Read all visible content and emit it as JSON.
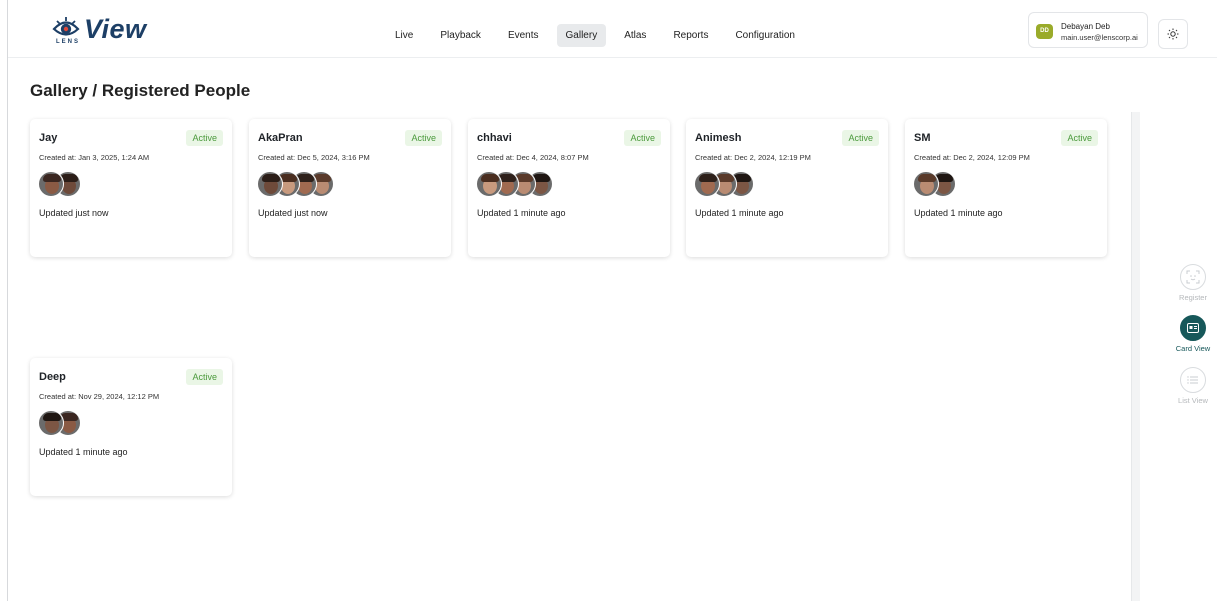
{
  "brand": {
    "name": "View",
    "sub": "LENS",
    "accent": "#1d3f66"
  },
  "nav": {
    "items": [
      {
        "label": "Live"
      },
      {
        "label": "Playback"
      },
      {
        "label": "Events"
      },
      {
        "label": "Gallery"
      },
      {
        "label": "Atlas"
      },
      {
        "label": "Reports"
      },
      {
        "label": "Configuration"
      }
    ],
    "active": "Gallery"
  },
  "user": {
    "initials": "DD",
    "name": "Debayan Deb",
    "email": "main.user@lenscorp.ai"
  },
  "page": {
    "title": "Gallery / Registered People"
  },
  "status_colors": {
    "active_bg": "#eaf6e6",
    "active_text": "#4b9a3c"
  },
  "people": [
    {
      "name": "Jay",
      "status": "Active",
      "created": "Created at: Jan 3, 2025, 1:24 AM",
      "updated": "Updated just now",
      "photo_count": 2
    },
    {
      "name": "AkaPran",
      "status": "Active",
      "created": "Created at: Dec 5, 2024, 3:16 PM",
      "updated": "Updated just now",
      "photo_count": 4
    },
    {
      "name": "chhavi",
      "status": "Active",
      "created": "Created at: Dec 4, 2024, 8:07 PM",
      "updated": "Updated 1 minute ago",
      "photo_count": 4
    },
    {
      "name": "Animesh",
      "status": "Active",
      "created": "Created at: Dec 2, 2024, 12:19 PM",
      "updated": "Updated 1 minute ago",
      "photo_count": 3
    },
    {
      "name": "SM",
      "status": "Active",
      "created": "Created at: Dec 2, 2024, 12:09 PM",
      "updated": "Updated 1 minute ago",
      "photo_count": 2
    },
    {
      "name": "Deep",
      "status": "Active",
      "created": "Created at: Nov 29, 2024, 12:12 PM",
      "updated": "Updated 1 minute ago",
      "photo_count": 2
    }
  ],
  "tools": [
    {
      "label": "Register",
      "icon": "face-scan-icon",
      "active": false
    },
    {
      "label": "Card View",
      "icon": "card-view-icon",
      "active": true
    },
    {
      "label": "List View",
      "icon": "list-view-icon",
      "active": false
    }
  ]
}
